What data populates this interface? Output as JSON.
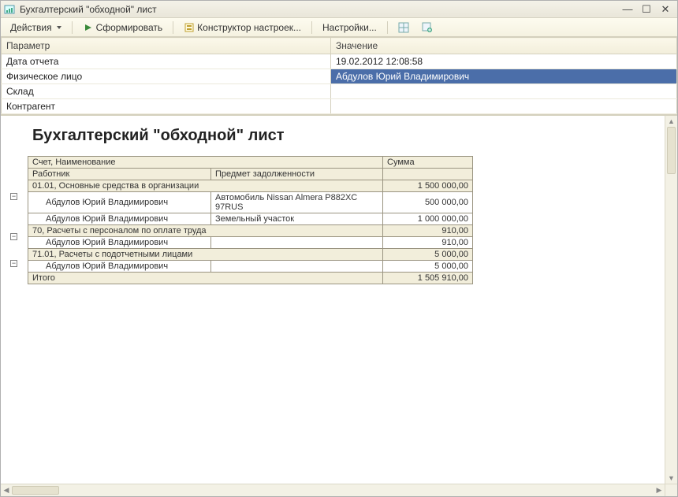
{
  "window": {
    "title": "Бухгалтерский \"обходной\" лист",
    "icon": "report-icon"
  },
  "toolbar": {
    "actions_label": "Действия",
    "form_label": "Сформировать",
    "settings_builder_label": "Конструктор настроек...",
    "settings_label": "Настройки..."
  },
  "params": {
    "header_param": "Параметр",
    "header_value": "Значение",
    "rows": [
      {
        "param": "Дата отчета",
        "value": "19.02.2012 12:08:58",
        "selected": false
      },
      {
        "param": "Физическое лицо",
        "value": "Абдулов Юрий Владимирович",
        "selected": true
      },
      {
        "param": "Склад",
        "value": "",
        "selected": false
      },
      {
        "param": "Контрагент",
        "value": "",
        "selected": false
      }
    ]
  },
  "report": {
    "title": "Бухгалтерский \"обходной\" лист",
    "col_account_name": "Счет, Наименование",
    "col_sum": "Сумма",
    "col_employee": "Работник",
    "col_subject": "Предмет задолженности",
    "rows": [
      {
        "type": "group",
        "account": "01.01, Основные средства в организации",
        "sum": "1 500 000,00"
      },
      {
        "type": "detail",
        "employee": "Абдулов Юрий Владимирович",
        "subject": "Автомобиль Nissan Almera P882XC 97RUS",
        "sum": "500 000,00"
      },
      {
        "type": "detail",
        "employee": "Абдулов Юрий Владимирович",
        "subject": "Земельный участок",
        "sum": "1 000 000,00"
      },
      {
        "type": "group",
        "account": "70, Расчеты с персоналом по оплате труда",
        "sum": "910,00"
      },
      {
        "type": "detail",
        "employee": "Абдулов Юрий Владимирович",
        "subject": "",
        "sum": "910,00"
      },
      {
        "type": "group",
        "account": "71.01, Расчеты с подотчетными лицами",
        "sum": "5 000,00"
      },
      {
        "type": "detail",
        "employee": "Абдулов Юрий Владимирович",
        "subject": "",
        "sum": "5 000,00"
      }
    ],
    "total_label": "Итого",
    "total_sum": "1 505 910,00"
  }
}
